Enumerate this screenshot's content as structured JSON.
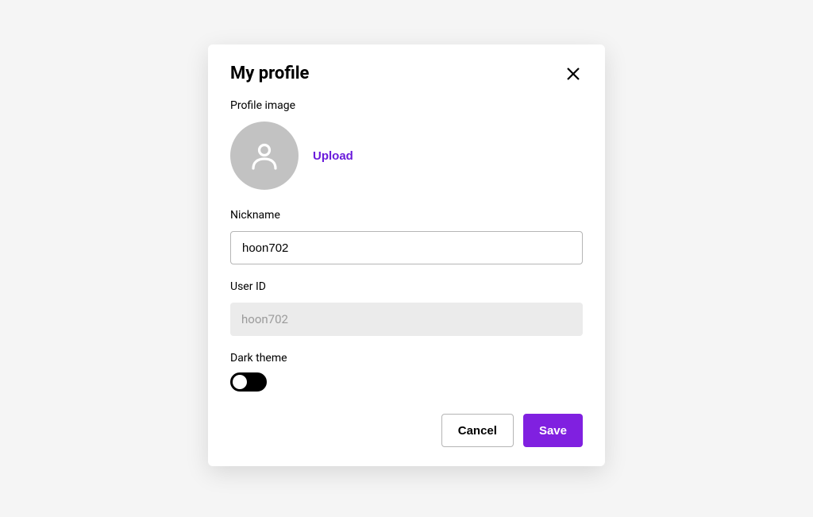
{
  "modal": {
    "title": "My profile",
    "profile_image": {
      "label": "Profile image",
      "upload_label": "Upload"
    },
    "nickname": {
      "label": "Nickname",
      "value": "hoon702"
    },
    "user_id": {
      "label": "User ID",
      "value": "hoon702"
    },
    "dark_theme": {
      "label": "Dark theme",
      "enabled": false
    },
    "actions": {
      "cancel_label": "Cancel",
      "save_label": "Save"
    }
  },
  "colors": {
    "accent": "#8020e0",
    "link": "#6a1bdb"
  }
}
